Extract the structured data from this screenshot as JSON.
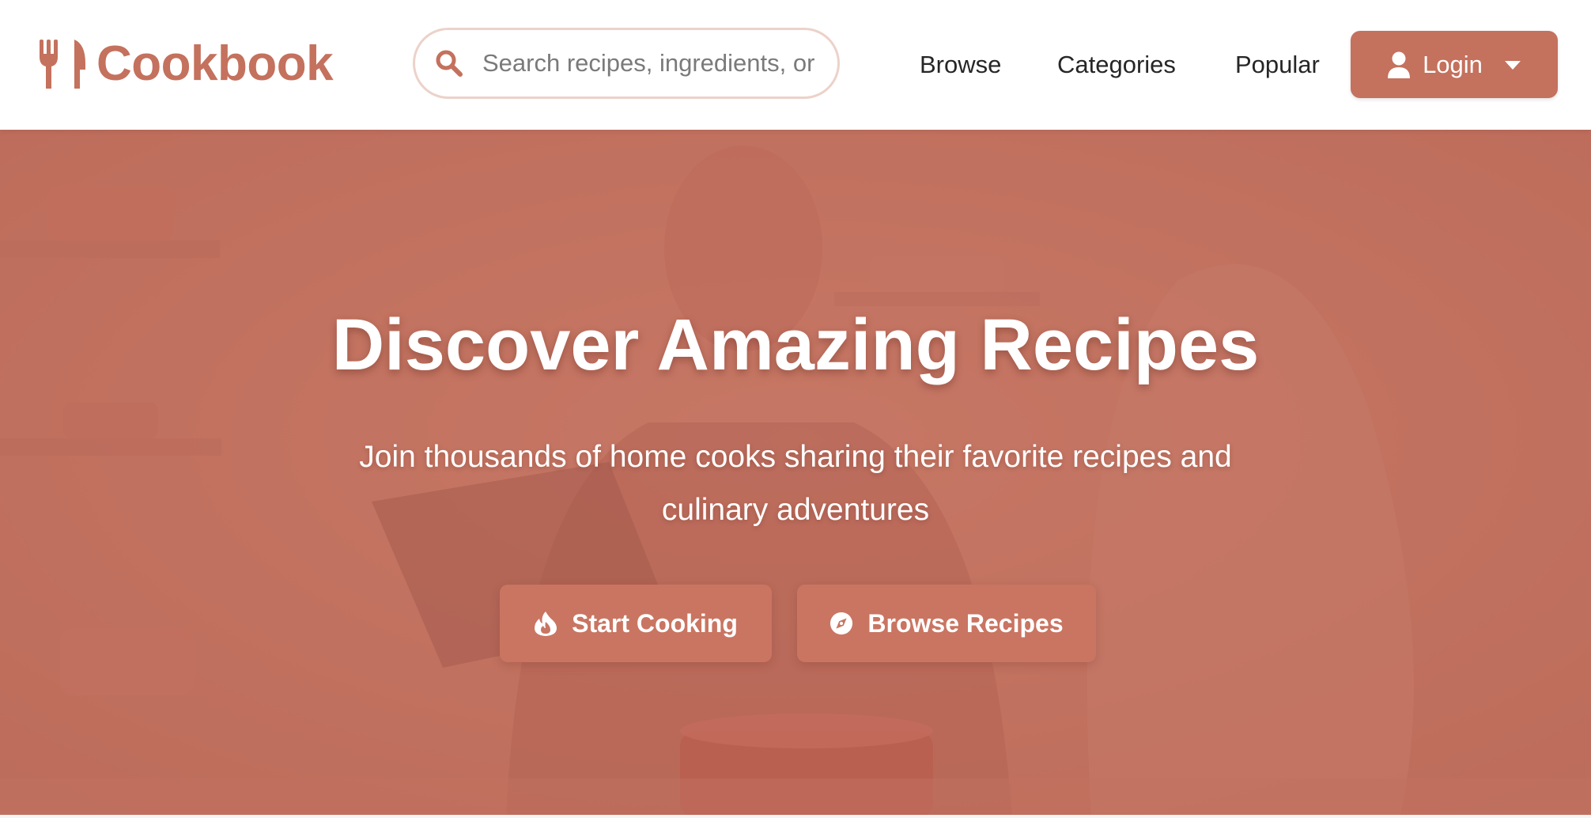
{
  "brand": {
    "name": "Cookbook",
    "icon": "utensils-icon",
    "color": "#c4715d"
  },
  "search": {
    "placeholder": "Search recipes, ingredients, or",
    "icon": "search-icon"
  },
  "nav": {
    "links": [
      "Browse",
      "Categories",
      "Popular"
    ]
  },
  "login": {
    "label": "Login",
    "icon": "user-icon",
    "dropdown_icon": "caret-down-icon"
  },
  "hero": {
    "title": "Discover Amazing Recipes",
    "subtitle": "Join thousands of home cooks sharing their favorite recipes and culinary adventures",
    "buttons": [
      {
        "label": "Start Cooking",
        "icon": "fire-icon"
      },
      {
        "label": "Browse Recipes",
        "icon": "compass-icon"
      }
    ],
    "overlay_color": "#c47462"
  },
  "colors": {
    "accent": "#c4715d",
    "text": "#262626",
    "white": "#ffffff"
  }
}
